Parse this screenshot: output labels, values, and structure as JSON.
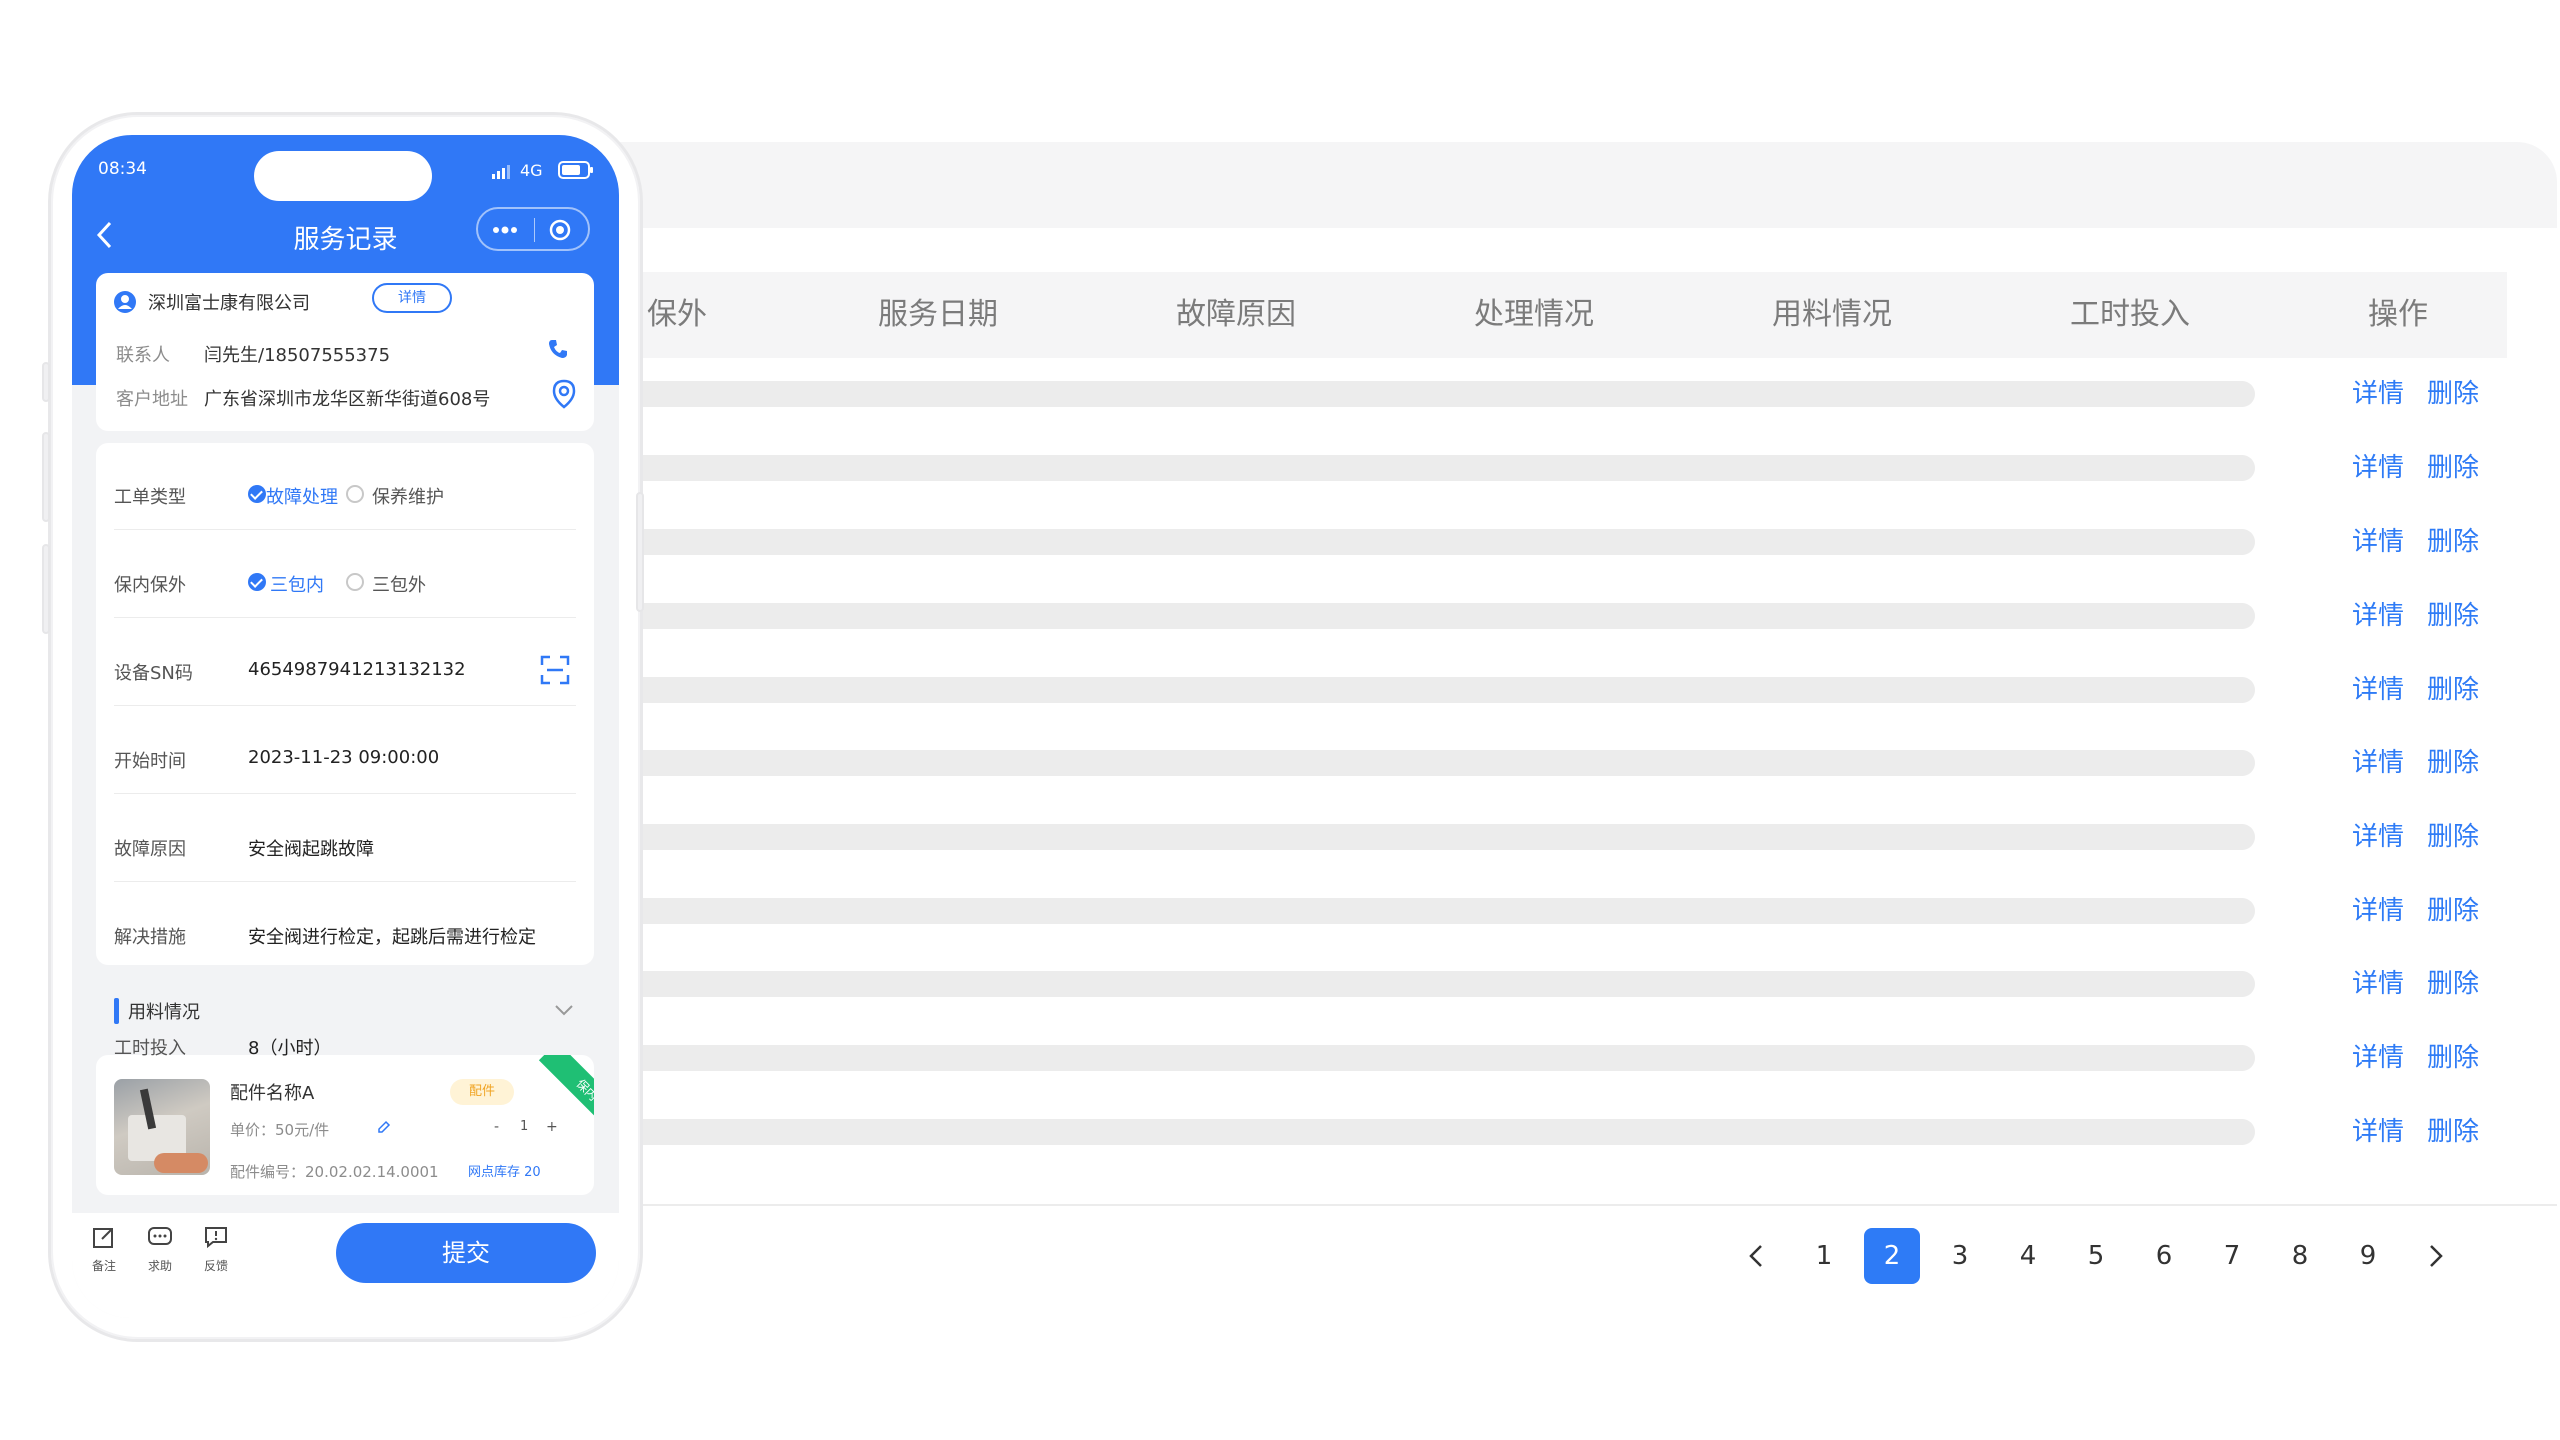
{
  "table": {
    "headers": [
      "保外",
      "服务日期",
      "故障原因",
      "处理情况",
      "用料情况",
      "工时投入",
      "操作"
    ],
    "rows": [
      {
        "detail": "详情",
        "delete": "删除"
      },
      {
        "detail": "详情",
        "delete": "删除"
      },
      {
        "detail": "详情",
        "delete": "删除"
      },
      {
        "detail": "详情",
        "delete": "删除"
      },
      {
        "detail": "详情",
        "delete": "删除"
      },
      {
        "detail": "详情",
        "delete": "删除"
      },
      {
        "detail": "详情",
        "delete": "删除"
      },
      {
        "detail": "详情",
        "delete": "删除"
      },
      {
        "detail": "详情",
        "delete": "删除"
      },
      {
        "detail": "详情",
        "delete": "删除"
      },
      {
        "detail": "详情",
        "delete": "删除"
      }
    ]
  },
  "pagination": {
    "pages": [
      "1",
      "2",
      "3",
      "4",
      "5",
      "6",
      "7",
      "8",
      "9"
    ],
    "current": "2",
    "accent": "#2e7bf6"
  },
  "phone": {
    "status": {
      "time": "08:34",
      "network": "4G"
    },
    "title": "服务记录",
    "customer": {
      "company": "深圳富士康有限公司",
      "detail_button": "详情",
      "contact_label": "联系人",
      "contact_value": "闫先生/18507555375",
      "address_label": "客户地址",
      "address_value": "广东省深圳市龙华区新华街道608号"
    },
    "form": {
      "order_type_label": "工单类型",
      "order_type_options": [
        "故障处理",
        "保养维护"
      ],
      "warranty_label": "保内保外",
      "warranty_options": [
        "三包内",
        "三包外"
      ],
      "sn_label": "设备SN码",
      "sn_value": "4654987941213132132",
      "start_label": "开始时间",
      "start_value": "2023-11-23 09:00:00",
      "fault_label": "故障原因",
      "fault_value": "安全阀起跳故障",
      "solution_label": "解决措施",
      "solution_value": "安全阀进行检定，起跳后需进行检定",
      "hours_label": "工时投入",
      "hours_value": "8（小时）"
    },
    "materials": {
      "section_title": "用料情况",
      "item": {
        "name": "配件名称A",
        "tag": "配件",
        "ribbon": "保内",
        "price": "单价：50元/件",
        "quantity": "1",
        "code": "配件编号：20.02.02.14.0001",
        "stock": "网点库存 20"
      }
    },
    "bottom": {
      "note": "备注",
      "help": "求助",
      "feedback": "反馈",
      "submit": "提交"
    },
    "brand_color": "#3078f6"
  }
}
